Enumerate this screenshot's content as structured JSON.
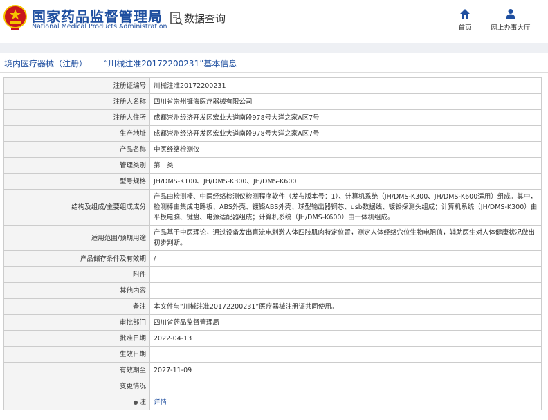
{
  "header": {
    "agency_cn": "国家药品监督管理局",
    "agency_en": "National Medical Products Administration",
    "query_label": "数据查询",
    "nav": [
      {
        "label": "首页",
        "icon": "home-icon"
      },
      {
        "label": "网上办事大厅",
        "icon": "user-icon"
      }
    ]
  },
  "breadcrumb": {
    "text": "境内医疗器械（注册）——“川械注准20172200231”基本信息"
  },
  "rows": [
    {
      "label": "注册证编号",
      "value": "川械注准20172200231"
    },
    {
      "label": "注册人名称",
      "value": "四川省崇州镛海医疗器械有限公司"
    },
    {
      "label": "注册人住所",
      "value": "成都崇州经济开发区宏业大道南段978号大洋之家A区7号"
    },
    {
      "label": "生产地址",
      "value": "成都崇州经济开发区宏业大道南段978号大洋之家A区7号"
    },
    {
      "label": "产品名称",
      "value": "中医经络检测仪"
    },
    {
      "label": "管理类别",
      "value": "第二类"
    },
    {
      "label": "型号规格",
      "value": "JH/DMS-K100、JH/DMS-K300、JH/DMS-K600"
    },
    {
      "label": "结构及组成/主要组成成分",
      "value": "产品由检测棒、中医经络检测仪检测程序软件（发布版本号：1）、计算机系统（JH/DMS-K300、JH/DMS-K600适用）组成。其中，检测棒由集成电路板、ABS外壳、镀铬ABS外壳、球型输出器铜芯、usb数据线、镀铬探测头组成；计算机系统（JH/DMS-K300）由平板电脑、键盘、电源适配器组成；计算机系统（JH/DMS-K600）由一体机组成。"
    },
    {
      "label": "适用范围/预期用途",
      "value": "产品基于中医理论，通过设备发出直流电刺激人体四肢肌肉特定位置，测定人体经络穴位生物电阻值，辅助医生对人体健康状况做出初步判断。"
    },
    {
      "label": "产品储存条件及有效期",
      "value": "/"
    },
    {
      "label": "附件",
      "value": ""
    },
    {
      "label": "其他内容",
      "value": ""
    },
    {
      "label": "备注",
      "value": "本文件与“川械注准20172200231”医疗器械注册证共同使用。"
    },
    {
      "label": "审批部门",
      "value": "四川省药品监督管理局"
    },
    {
      "label": "批准日期",
      "value": "2022-04-13"
    },
    {
      "label": "生效日期",
      "value": ""
    },
    {
      "label": "有效期至",
      "value": "2027-11-09"
    },
    {
      "label": "变更情况",
      "value": ""
    },
    {
      "label": "注",
      "value": "详情"
    }
  ],
  "colors": {
    "brand_blue": "#1f4fa0",
    "emblem_red": "#c8161d",
    "emblem_gold": "#f5c400"
  }
}
